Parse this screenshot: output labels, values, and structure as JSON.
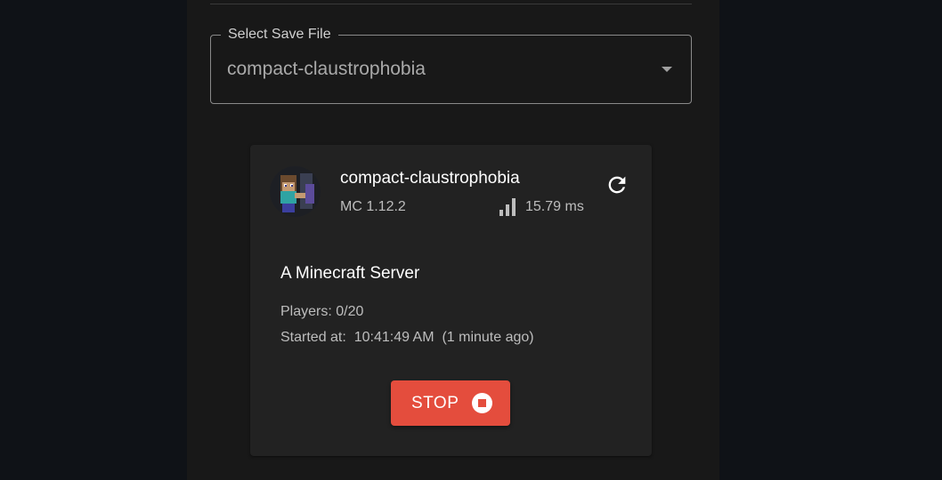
{
  "save_select": {
    "label": "Select Save File",
    "value": "compact-claustrophobia"
  },
  "server_card": {
    "name": "compact-claustrophobia",
    "version": "MC 1.12.2",
    "ping": "15.79 ms",
    "motd": "A Minecraft Server",
    "players": "Players: 0/20",
    "started": "Started at:  10:41:49 AM  (1 minute ago)",
    "stop_label": "STOP"
  },
  "icons": {
    "avatar": "minecraft-player-avatar",
    "signal": "signal-bars-icon",
    "refresh": "refresh-icon",
    "stop": "stop-circle-icon",
    "caret": "dropdown-caret-icon"
  },
  "colors": {
    "page_bg": "#0f1217",
    "panel_bg": "#181818",
    "card_bg": "#222222",
    "stop_button": "#e44d3d"
  }
}
